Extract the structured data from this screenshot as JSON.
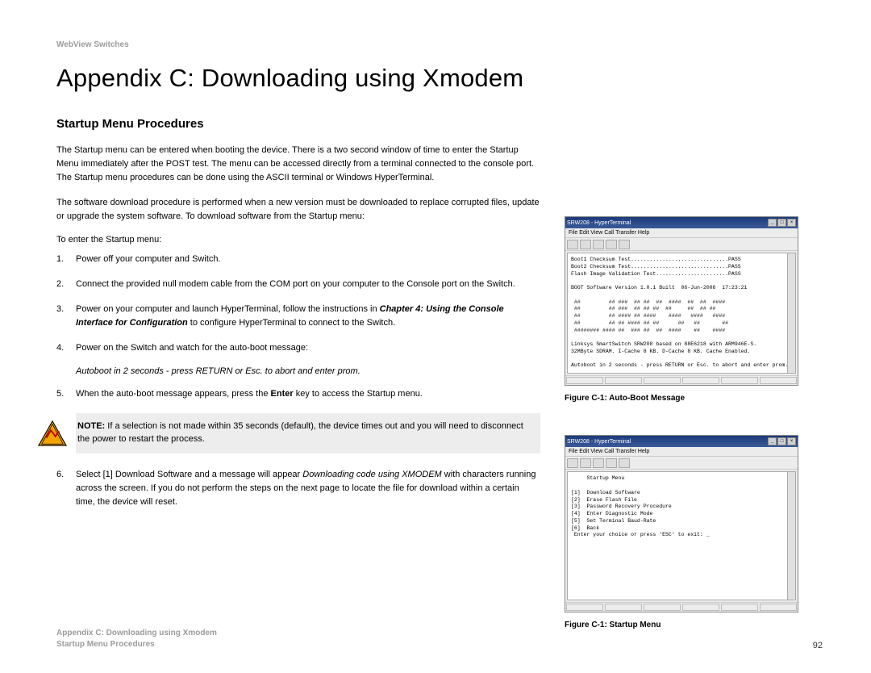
{
  "header_label": "WebView Switches",
  "page_title": "Appendix C: Downloading using Xmodem",
  "section_heading": "Startup Menu Procedures",
  "intro_p1": "The Startup menu can be entered when booting the device. There is a two second window of time to enter the Startup Menu immediately after the POST test. The menu can be accessed directly from a terminal connected to the console port. The Startup menu procedures can be done using the ASCII terminal or Windows HyperTerminal.",
  "intro_p2": "The software download procedure is performed when a new version must be downloaded to replace corrupted files, update or upgrade the system software. To download software from the Startup menu:",
  "lead_in": "To enter the Startup menu:",
  "steps": {
    "s1": "Power off your computer and Switch.",
    "s2": "Connect the provided null modem cable from the COM port on your computer to the Console port on the Switch.",
    "s3a": "Power on your computer and launch HyperTerminal, follow the instructions in ",
    "s3b": "Chapter 4: Using the Console Interface for Configuration",
    "s3c": " to configure HyperTerminal to connect to the Switch.",
    "s4": "Power on the Switch and watch for the auto-boot message:",
    "autoboot": "Autoboot in 2 seconds - press RETURN or Esc. to abort and enter prom.",
    "s5a": "When the auto-boot message appears, press the ",
    "s5b": "Enter",
    "s5c": " key to access the Startup menu.",
    "note_label": "NOTE:",
    "note_body": "  If a selection is not made within 35 seconds (default), the device times out and you will need to disconnect the power to restart the process.",
    "s6a": "Select [1] Download Software and a message will appear ",
    "s6b": "Downloading code using XMODEM",
    "s6c": " with characters running across the screen. If you do not perform the steps on the next page to locate the file for download within a certain time, the device will reset."
  },
  "figures": {
    "f1": {
      "win_title": "SRW208 - HyperTerminal",
      "menubar": "File  Edit  View  Call  Transfer  Help",
      "body": "Boot1 Checksum Test...............................PASS\nBoot2 Checksum Test...............................PASS\nFlash Image Validation Test.......................PASS\n\nBOOT Software Version 1.0.1 Built  06-Jun-2006  17:23:21\n\n ##         ## ###  ## ##  ##  ####  ##  ##  ####\n ##         ## ###  ## ## ##  ##     ##  ## ##\n ##         ## #### ## ####    ####   ####   ####\n ##         ## ## #### ## ##      ##   ##       ##\n ######## #### ##  ### ##  ##  ####    ##    ####\n\nLinksys SmartSwitch SRW208 based on 88E6218 with ARM946E-S.\n32MByte SDRAM. I-Cache 8 KB. D-Cache 8 KB. Cache Enabled.\n\nAutoboot in 2 seconds - press RETURN or Esc. to abort and enter prom.",
      "caption": "Figure C-1: Auto-Boot Message"
    },
    "f2": {
      "win_title": "SRW208 - HyperTerminal",
      "menubar": "File  Edit  View  Call  Transfer  Help",
      "body": "     Startup Menu\n\n[1]  Download Software\n[2]  Erase Flash File\n[3]  Password Recovery Procedure\n[4]  Enter Diagnostic Mode\n[5]  Set Terminal Baud-Rate\n[6]  Back\n Enter your choice or press 'ESC' to exit: _",
      "caption": "Figure C-1: Startup Menu"
    }
  },
  "footer": {
    "line1": "Appendix C: Downloading using Xmodem",
    "line2": "Startup Menu Procedures",
    "page_no": "92"
  }
}
